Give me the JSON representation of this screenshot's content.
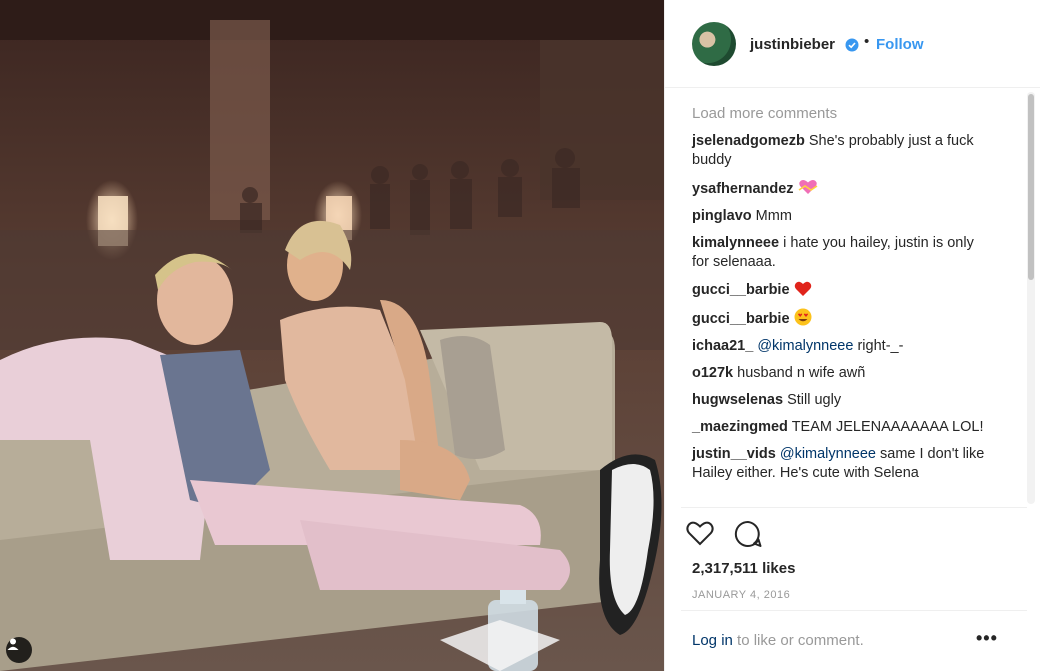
{
  "post": {
    "username": "justinbieber",
    "follow_label": "Follow",
    "dot": "•",
    "load_more": "Load more comments",
    "comments": [
      {
        "user": "jselenadgomezb",
        "text": "She's probably just a fuck buddy"
      },
      {
        "user": "ysafhernandez",
        "text": "",
        "emoji": "heart-with-ribbon"
      },
      {
        "user": "pinglavo",
        "text": "Mmm"
      },
      {
        "user": "kimalynneee",
        "text": "i hate you hailey, justin is only for selenaaa."
      },
      {
        "user": "gucci__barbie",
        "text": "",
        "emoji": "red-heart"
      },
      {
        "user": "gucci__barbie",
        "text": "",
        "emoji": "heart-eyes"
      },
      {
        "user": "ichaa21_",
        "mention": "@kimalynneee",
        "text": " right-_-"
      },
      {
        "user": "o127k",
        "text": "husband n wife awñ"
      },
      {
        "user": "hugwselenas",
        "text": "Still ugly"
      },
      {
        "user": "_maezingmed",
        "text": "TEAM JELENAAAAAAA LOL!"
      },
      {
        "user": "justin__vids",
        "mention": "@kimalynneee",
        "text": " same I don't like Hailey either. He's cute with Selena"
      }
    ],
    "likes": "2,317,511 likes",
    "date": "JANUARY 4, 2016",
    "login_link": "Log in",
    "login_rest": " to like or comment.",
    "more_label": "•••"
  },
  "icons": {
    "verified": "verified-badge-icon",
    "like": "heart-outline-icon",
    "comment": "comment-bubble-icon",
    "user_tag": "user-tag-icon"
  },
  "colors": {
    "link": "#3897f0",
    "username": "#262626",
    "muted": "#999999",
    "mention": "#003569"
  }
}
